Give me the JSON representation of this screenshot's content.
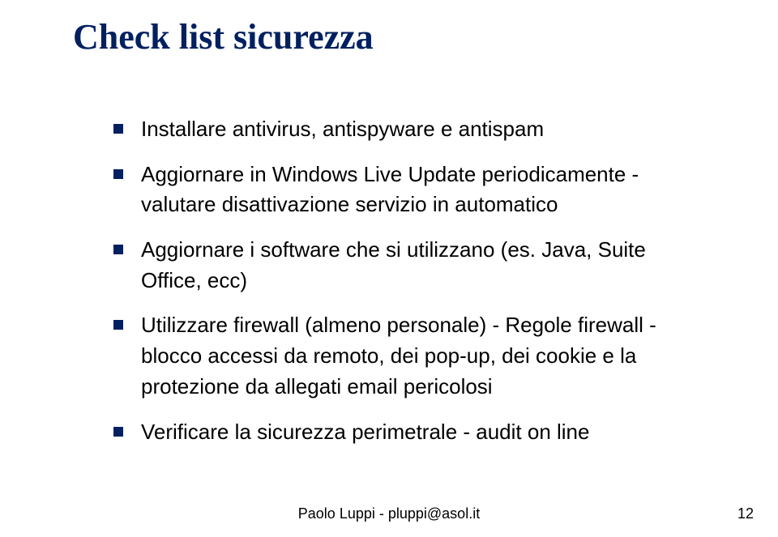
{
  "title": "Check list sicurezza",
  "bullets": [
    "Installare antivirus, antispyware e antispam",
    "Aggiornare in Windows Live Update periodicamente - valutare disattivazione servizio in automatico",
    "Aggiornare i software che si utilizzano (es. Java, Suite Office, ecc)",
    "Utilizzare firewall (almeno personale) - Regole firewall - blocco accessi da remoto, dei pop-up, dei cookie e la protezione da allegati email pericolosi",
    "Verificare la sicurezza perimetrale - audit on line"
  ],
  "footer": "Paolo Luppi - pluppi@asol.it",
  "page_number": "12"
}
